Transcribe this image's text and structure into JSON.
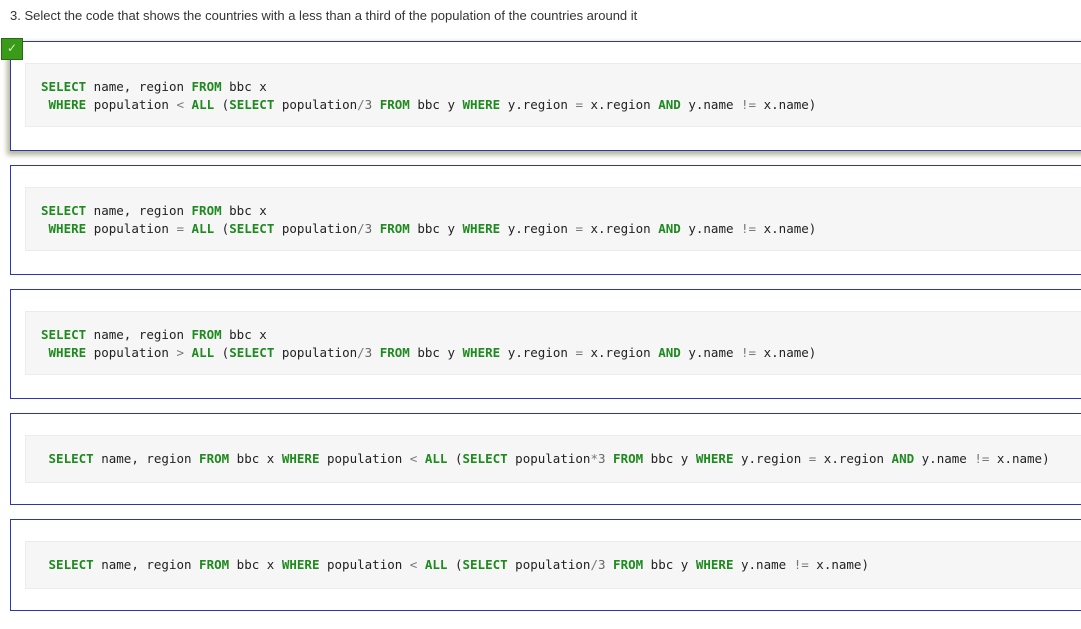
{
  "question": {
    "text": "3. Select the code that shows the countries with a less than a third of the population of the countries around it"
  },
  "check_icon": {
    "glyph": "✓",
    "color": "#3a9a1a"
  },
  "options": [
    {
      "selected": true,
      "lines": [
        [
          [
            "kw",
            "SELECT"
          ],
          [
            "t",
            " name, region "
          ],
          [
            "kw",
            "FROM"
          ],
          [
            "t",
            " bbc x"
          ]
        ],
        [
          [
            "t",
            " "
          ],
          [
            "kw",
            "WHERE"
          ],
          [
            "t",
            " population "
          ],
          [
            "op",
            "<"
          ],
          [
            "t",
            " "
          ],
          [
            "kw",
            "ALL"
          ],
          [
            "t",
            " ("
          ],
          [
            "kw",
            "SELECT"
          ],
          [
            "t",
            " population"
          ],
          [
            "op",
            "/"
          ],
          [
            "num",
            "3"
          ],
          [
            "t",
            " "
          ],
          [
            "kw",
            "FROM"
          ],
          [
            "t",
            " bbc y "
          ],
          [
            "kw",
            "WHERE"
          ],
          [
            "t",
            " y.region "
          ],
          [
            "op",
            "="
          ],
          [
            "t",
            " x.region "
          ],
          [
            "kw",
            "AND"
          ],
          [
            "t",
            " y.name "
          ],
          [
            "op",
            "!="
          ],
          [
            "t",
            " x.name)"
          ]
        ]
      ]
    },
    {
      "selected": false,
      "lines": [
        [
          [
            "kw",
            "SELECT"
          ],
          [
            "t",
            " name, region "
          ],
          [
            "kw",
            "FROM"
          ],
          [
            "t",
            " bbc x"
          ]
        ],
        [
          [
            "t",
            " "
          ],
          [
            "kw",
            "WHERE"
          ],
          [
            "t",
            " population "
          ],
          [
            "op",
            "="
          ],
          [
            "t",
            " "
          ],
          [
            "kw",
            "ALL"
          ],
          [
            "t",
            " ("
          ],
          [
            "kw",
            "SELECT"
          ],
          [
            "t",
            " population"
          ],
          [
            "op",
            "/"
          ],
          [
            "num",
            "3"
          ],
          [
            "t",
            " "
          ],
          [
            "kw",
            "FROM"
          ],
          [
            "t",
            " bbc y "
          ],
          [
            "kw",
            "WHERE"
          ],
          [
            "t",
            " y.region "
          ],
          [
            "op",
            "="
          ],
          [
            "t",
            " x.region "
          ],
          [
            "kw",
            "AND"
          ],
          [
            "t",
            " y.name "
          ],
          [
            "op",
            "!="
          ],
          [
            "t",
            " x.name)"
          ]
        ]
      ]
    },
    {
      "selected": false,
      "lines": [
        [
          [
            "kw",
            "SELECT"
          ],
          [
            "t",
            " name, region "
          ],
          [
            "kw",
            "FROM"
          ],
          [
            "t",
            " bbc x"
          ]
        ],
        [
          [
            "t",
            " "
          ],
          [
            "kw",
            "WHERE"
          ],
          [
            "t",
            " population "
          ],
          [
            "op",
            ">"
          ],
          [
            "t",
            " "
          ],
          [
            "kw",
            "ALL"
          ],
          [
            "t",
            " ("
          ],
          [
            "kw",
            "SELECT"
          ],
          [
            "t",
            " population"
          ],
          [
            "op",
            "/"
          ],
          [
            "num",
            "3"
          ],
          [
            "t",
            " "
          ],
          [
            "kw",
            "FROM"
          ],
          [
            "t",
            " bbc y "
          ],
          [
            "kw",
            "WHERE"
          ],
          [
            "t",
            " y.region "
          ],
          [
            "op",
            "="
          ],
          [
            "t",
            " x.region "
          ],
          [
            "kw",
            "AND"
          ],
          [
            "t",
            " y.name "
          ],
          [
            "op",
            "!="
          ],
          [
            "t",
            " x.name)"
          ]
        ]
      ]
    },
    {
      "selected": false,
      "lines": [
        [
          [
            "t",
            " "
          ],
          [
            "kw",
            "SELECT"
          ],
          [
            "t",
            " name, region "
          ],
          [
            "kw",
            "FROM"
          ],
          [
            "t",
            " bbc x "
          ],
          [
            "kw",
            "WHERE"
          ],
          [
            "t",
            " population "
          ],
          [
            "op",
            "<"
          ],
          [
            "t",
            " "
          ],
          [
            "kw",
            "ALL"
          ],
          [
            "t",
            " ("
          ],
          [
            "kw",
            "SELECT"
          ],
          [
            "t",
            " population"
          ],
          [
            "op",
            "*"
          ],
          [
            "num",
            "3"
          ],
          [
            "t",
            " "
          ],
          [
            "kw",
            "FROM"
          ],
          [
            "t",
            " bbc y "
          ],
          [
            "kw",
            "WHERE"
          ],
          [
            "t",
            " y.region "
          ],
          [
            "op",
            "="
          ],
          [
            "t",
            " x.region "
          ],
          [
            "kw",
            "AND"
          ],
          [
            "t",
            " y.name "
          ],
          [
            "op",
            "!="
          ],
          [
            "t",
            " x.name)"
          ]
        ]
      ]
    },
    {
      "selected": false,
      "lines": [
        [
          [
            "t",
            " "
          ],
          [
            "kw",
            "SELECT"
          ],
          [
            "t",
            " name, region "
          ],
          [
            "kw",
            "FROM"
          ],
          [
            "t",
            " bbc x "
          ],
          [
            "kw",
            "WHERE"
          ],
          [
            "t",
            " population "
          ],
          [
            "op",
            "<"
          ],
          [
            "t",
            " "
          ],
          [
            "kw",
            "ALL"
          ],
          [
            "t",
            " ("
          ],
          [
            "kw",
            "SELECT"
          ],
          [
            "t",
            " population"
          ],
          [
            "op",
            "/"
          ],
          [
            "num",
            "3"
          ],
          [
            "t",
            " "
          ],
          [
            "kw",
            "FROM"
          ],
          [
            "t",
            " bbc y "
          ],
          [
            "kw",
            "WHERE"
          ],
          [
            "t",
            " y.name "
          ],
          [
            "op",
            "!="
          ],
          [
            "t",
            " x.name)"
          ]
        ]
      ]
    }
  ]
}
